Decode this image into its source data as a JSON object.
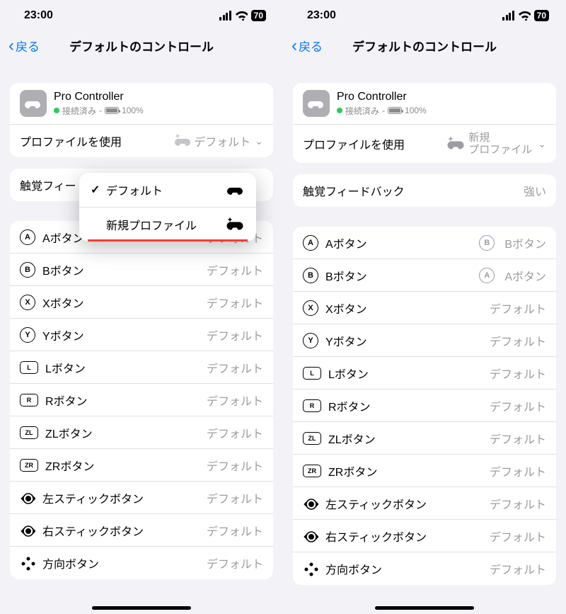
{
  "status": {
    "time": "23:00",
    "battery": "70"
  },
  "nav": {
    "back": "戻る",
    "title": "デフォルトのコントロール"
  },
  "controller": {
    "name": "Pro Controller",
    "status": "接続済み",
    "dash": "-",
    "battery": "100%"
  },
  "profile_row": {
    "label": "プロファイルを使用",
    "value_left": "デフォルト",
    "value_right_l1": "新規",
    "value_right_l2": "プロファイル",
    "chev": "◇"
  },
  "haptic_row": {
    "label": "触覚フィー",
    "label_full": "触覚フィードバック",
    "value": "強い"
  },
  "popover": {
    "opt1": "デフォルト",
    "opt2": "新規プロファイル"
  },
  "buttons_left": [
    {
      "badge": "A",
      "label": "Aボタン",
      "value": "デフォルト",
      "shape": "circle"
    },
    {
      "badge": "B",
      "label": "Bボタン",
      "value": "デフォルト",
      "shape": "circle"
    },
    {
      "badge": "X",
      "label": "Xボタン",
      "value": "デフォルト",
      "shape": "circle"
    },
    {
      "badge": "Y",
      "label": "Yボタン",
      "value": "デフォルト",
      "shape": "circle"
    },
    {
      "badge": "L",
      "label": "Lボタン",
      "value": "デフォルト",
      "shape": "rect"
    },
    {
      "badge": "R",
      "label": "Rボタン",
      "value": "デフォルト",
      "shape": "rect"
    },
    {
      "badge": "ZL",
      "label": "ZLボタン",
      "value": "デフォルト",
      "shape": "rect"
    },
    {
      "badge": "ZR",
      "label": "ZRボタン",
      "value": "デフォルト",
      "shape": "rect"
    },
    {
      "badge": "stickL",
      "label": "左スティックボタン",
      "value": "デフォルト",
      "shape": "stick"
    },
    {
      "badge": "stickR",
      "label": "右スティックボタン",
      "value": "デフォルト",
      "shape": "stick"
    },
    {
      "badge": "dpad",
      "label": "方向ボタン",
      "value": "デフォルト",
      "shape": "dpad"
    }
  ],
  "buttons_right": [
    {
      "badge": "A",
      "label": "Aボタン",
      "value": "Bボタン",
      "vbadge": "B",
      "shape": "circle"
    },
    {
      "badge": "B",
      "label": "Bボタン",
      "value": "Aボタン",
      "vbadge": "A",
      "shape": "circle"
    },
    {
      "badge": "X",
      "label": "Xボタン",
      "value": "デフォルト",
      "shape": "circle"
    },
    {
      "badge": "Y",
      "label": "Yボタン",
      "value": "デフォルト",
      "shape": "circle"
    },
    {
      "badge": "L",
      "label": "Lボタン",
      "value": "デフォルト",
      "shape": "rect"
    },
    {
      "badge": "R",
      "label": "Rボタン",
      "value": "デフォルト",
      "shape": "rect"
    },
    {
      "badge": "ZL",
      "label": "ZLボタン",
      "value": "デフォルト",
      "shape": "rect"
    },
    {
      "badge": "ZR",
      "label": "ZRボタン",
      "value": "デフォルト",
      "shape": "rect"
    },
    {
      "badge": "stickL",
      "label": "左スティックボタン",
      "value": "デフォルト",
      "shape": "stick"
    },
    {
      "badge": "stickR",
      "label": "右スティックボタン",
      "value": "デフォルト",
      "shape": "stick"
    },
    {
      "badge": "dpad",
      "label": "方向ボタン",
      "value": "デフォルト",
      "shape": "dpad"
    }
  ]
}
